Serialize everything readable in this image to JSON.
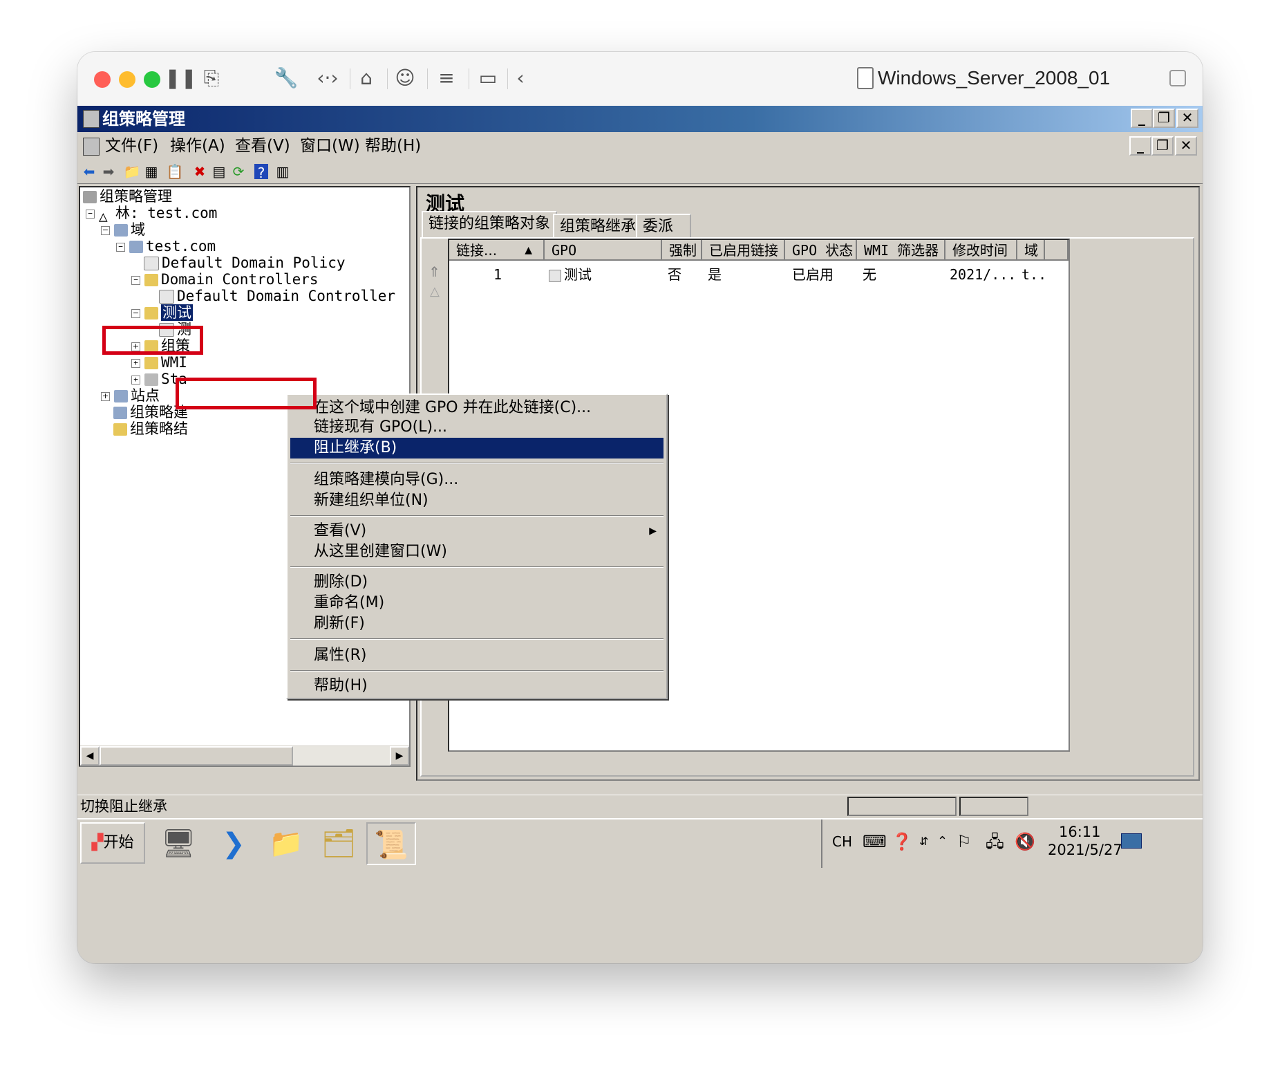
{
  "vm": {
    "title": "Windows_Server_2008_01",
    "toolbar_icons": [
      "pause-icon",
      "snapshot-icon",
      "wrench-icon",
      "code-icon",
      "drive-icon",
      "user-icon",
      "list-icon",
      "folder-icon",
      "back-icon"
    ]
  },
  "mmc": {
    "title": "组策略管理",
    "menu": [
      "文件(F)",
      "操作(A)",
      "查看(V)",
      "窗口(W)",
      "帮助(H)"
    ]
  },
  "tree": {
    "root": "组策略管理",
    "forest": "林: test.com",
    "domains": "域",
    "domain": "test.com",
    "default_policy": "Default Domain Policy",
    "dc_ou": "Domain Controllers",
    "dc_policy": "Default Domain Controller",
    "selected_ou": "测试",
    "child_1": "测",
    "child_2": "组策",
    "child_3": "WMI",
    "child_4": "Sta",
    "sites": "站点",
    "modeling": "组策略建",
    "results": "组策略结"
  },
  "right": {
    "title": "测试",
    "tabs": [
      "链接的组策略对象",
      "组策略继承",
      "委派"
    ],
    "columns": [
      "链接...",
      "GPO",
      "强制",
      "已启用链接",
      "GPO 状态",
      "WMI 筛选器",
      "修改时间",
      "域"
    ],
    "row": [
      "1",
      "测试",
      "否",
      "是",
      "已启用",
      "无",
      "2021/...",
      "t.."
    ]
  },
  "context_menu": {
    "items": [
      "在这个域中创建 GPO 并在此处链接(C)...",
      "链接现有 GPO(L)...",
      "阻止继承(B)",
      "组策略建模向导(G)...",
      "新建组织单位(N)",
      "查看(V)",
      "从这里创建窗口(W)",
      "删除(D)",
      "重命名(M)",
      "刷新(F)",
      "属性(R)",
      "帮助(H)"
    ]
  },
  "status": {
    "text": "切换阻止继承"
  },
  "taskbar": {
    "start": "开始",
    "lang": "CH",
    "time": "16:11",
    "date": "2021/5/27"
  },
  "colors": {
    "selection": "#0a246a",
    "highlight_box": "#d40015",
    "win_bg": "#d4d0c8"
  }
}
